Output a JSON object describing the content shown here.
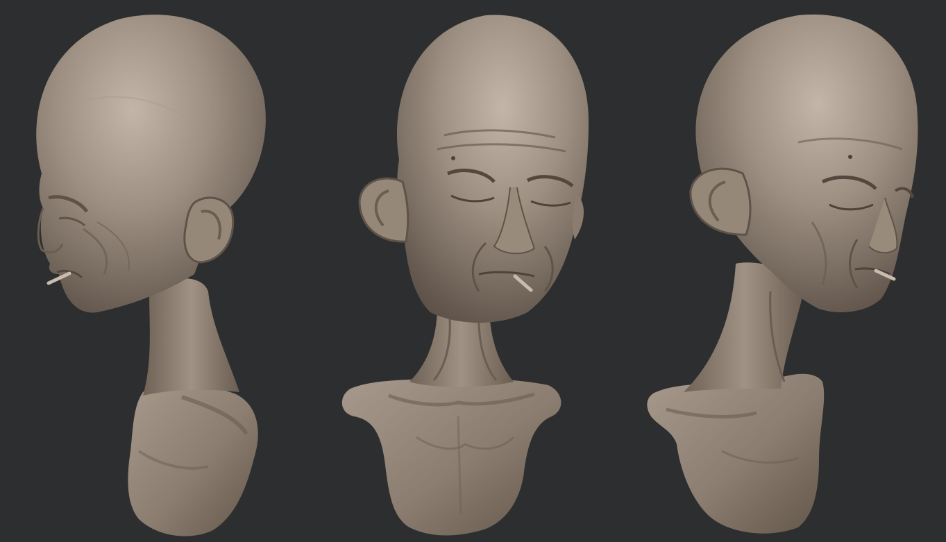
{
  "scene": {
    "background_color": "#2d2e2f",
    "clay_color": "#8e7f72",
    "clay_highlight_color": "#c1b4a6",
    "clay_shadow_color": "#5c5047",
    "views": [
      {
        "id": "left-profile",
        "label_visible": false
      },
      {
        "id": "front",
        "label_visible": false
      },
      {
        "id": "right-three-quarter",
        "label_visible": false
      }
    ]
  }
}
